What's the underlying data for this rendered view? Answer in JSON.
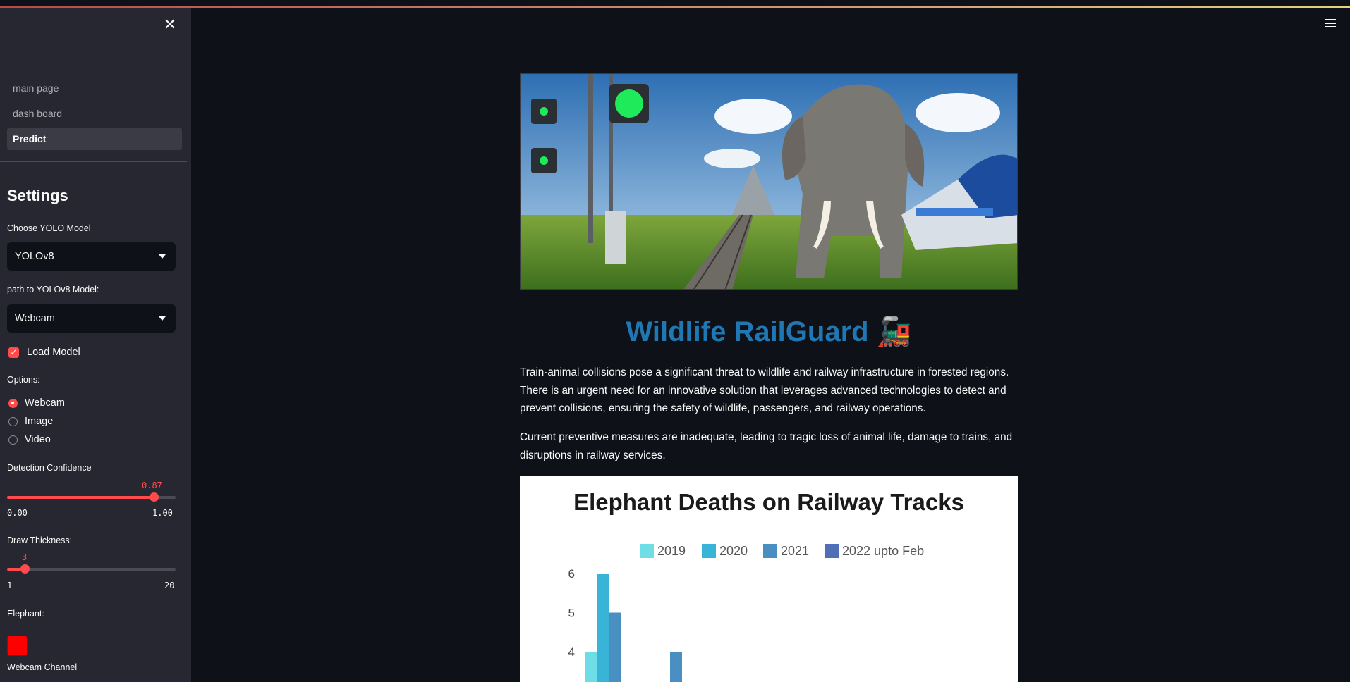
{
  "sidebar": {
    "close_icon": "close-icon",
    "nav": [
      {
        "label": "main page",
        "active": false
      },
      {
        "label": "dash board",
        "active": false
      },
      {
        "label": "Predict",
        "active": true
      }
    ],
    "settings_title": "Settings",
    "model_label": "Choose YOLO Model",
    "model_value": "YOLOv8",
    "path_label": "path to YOLOv8 Model:",
    "path_value": "Webcam",
    "load_model_label": "Load Model",
    "load_model_checked": true,
    "options_label": "Options:",
    "options": [
      {
        "label": "Webcam",
        "selected": true
      },
      {
        "label": "Image",
        "selected": false
      },
      {
        "label": "Video",
        "selected": false
      }
    ],
    "confidence": {
      "label": "Detection Confidence",
      "value": "0.87",
      "min": "0.00",
      "max": "1.00",
      "fraction": 0.87
    },
    "thickness": {
      "label": "Draw Thickness:",
      "value": "3",
      "min": "1",
      "max": "20",
      "fraction": 0.105
    },
    "elephant_label": "Elephant:",
    "elephant_color": "#ff0000",
    "webcam_channel_label": "Webcam Channel"
  },
  "main": {
    "menu_icon": "hamburger-menu-icon",
    "title": "Wildlife RailGuard 🚂",
    "paragraph1": "Train-animal collisions pose a significant threat to wildlife and railway infrastructure in forested regions. There is an urgent need for an innovative solution that leverages advanced technologies to detect and prevent collisions, ensuring the safety of wildlife, passengers, and railway operations.",
    "paragraph2": "Current preventive measures are inadequate, leading to tragic loss of animal life, damage to trains, and disruptions in railway services."
  },
  "colors": {
    "accent": "#ff4b4b",
    "title": "#1f78b4",
    "background": "#0e1117",
    "sidebar": "#262730"
  },
  "chart_data": {
    "type": "bar",
    "title": "Elephant Deaths on Railway Tracks",
    "series": [
      {
        "name": "2019",
        "color": "#6fdde6",
        "values": [
          4,
          null
        ]
      },
      {
        "name": "2020",
        "color": "#38b5d6",
        "values": [
          6,
          null
        ]
      },
      {
        "name": "2021",
        "color": "#4a8fc2",
        "values": [
          5,
          4
        ]
      },
      {
        "name": "2022 upto Feb",
        "color": "#4f6fb6",
        "values": [
          null,
          null
        ]
      }
    ],
    "yticks": [
      "4",
      "5",
      "6"
    ],
    "ylim": [
      3.5,
      6.2
    ],
    "legend": "top"
  }
}
